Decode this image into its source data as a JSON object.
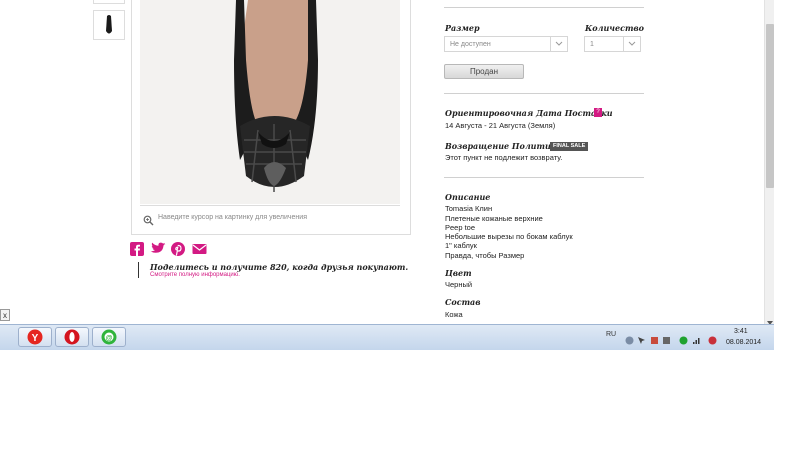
{
  "zoom_hint": "Наведите курсор на картинку для увеличения",
  "share": {
    "title": "Поделитесь и получите 820, когда друзья покупают.",
    "link": "Смотрите полную информацию."
  },
  "size": {
    "label": "Размер",
    "value": "Не доступен"
  },
  "quantity": {
    "label": "Количество",
    "value": "1"
  },
  "sold_button": "Продан",
  "delivery": {
    "label": "Ориентировочная Дата Поставки",
    "badge": "?",
    "value": "14 Августа - 21 Августа (Земля)"
  },
  "returns": {
    "label": "Возвращение Политики",
    "badge": "FINAL SALE",
    "value": "Этот пункт не подлежит возврату."
  },
  "description": {
    "label": "Описание",
    "lines": [
      "Tomasia Клин",
      "Плетеные кожаные верхние",
      "Peep toe",
      "Небольшие вырезы по бокам каблук",
      "1\" каблук",
      "Правда, чтобы Размер"
    ]
  },
  "color": {
    "label": "Цвет",
    "value": "Черный"
  },
  "composition": {
    "label": "Состав",
    "value": "Кожа"
  },
  "close_label": "x",
  "accent_color": "#d31a83",
  "taskbar": {
    "apps": [
      "yandex-browser",
      "opera",
      "icq"
    ],
    "language": "RU",
    "time": "3:41",
    "date": "08.08.2014"
  }
}
